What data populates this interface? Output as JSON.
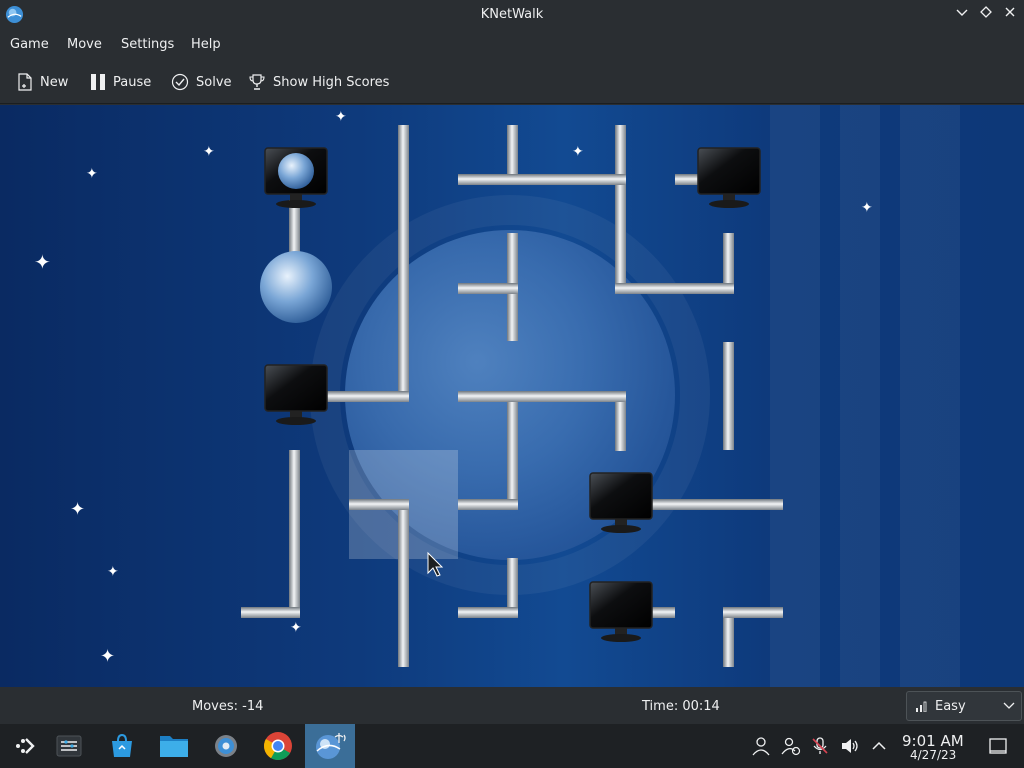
{
  "window": {
    "title": "KNetWalk"
  },
  "menu": {
    "items": [
      "Game",
      "Move",
      "Settings",
      "Help"
    ]
  },
  "toolbar": {
    "new_label": "New",
    "pause_label": "Pause",
    "solve_label": "Solve",
    "highscores_label": "Show High Scores"
  },
  "status": {
    "moves": "Moves: -14",
    "time": "Time: 00:14",
    "difficulty": "Easy"
  },
  "taskbar": {
    "items": [
      "app-launcher-icon",
      "task-manager-icon",
      "discover-store-icon",
      "file-manager-icon",
      "system-settings-icon",
      "chrome-icon",
      "knetwalk-icon"
    ],
    "clock_time": "9:01 AM",
    "clock_date": "4/27/23"
  },
  "colors": {
    "accent": "#3daee9",
    "board": "#0e3a7c",
    "pipe": "#c8ccd0"
  }
}
